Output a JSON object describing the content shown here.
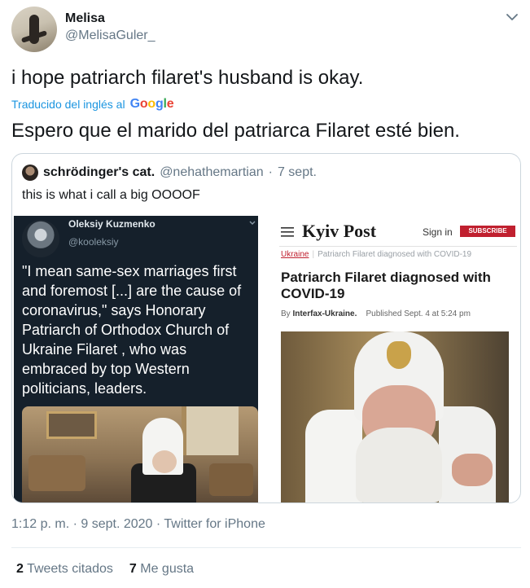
{
  "author": {
    "name": "Melisa",
    "handle": "@MelisaGuler_"
  },
  "tweet": {
    "text": "i hope patriarch filaret's husband is okay.",
    "translated_label": "Traducido del inglés al",
    "google_letters": [
      "G",
      "o",
      "o",
      "g",
      "l",
      "e"
    ],
    "translation": "Espero que el marido del patriarca Filaret esté bien."
  },
  "quoted": {
    "name": "schrödinger's cat.",
    "handle": "@nehathemartian",
    "dot": "·",
    "date": "7 sept.",
    "text": "this is what i call a big OOOOF",
    "left_image": {
      "name": "Oleksiy Kuzmenko",
      "handle": "@kooleksiy",
      "text": "\"I mean same-sex marriages first and foremost [...] are the cause of coronavirus,\" says Honorary Patriarch of Orthodox Church of Ukraine Filaret , who was embraced by top Western politicians, leaders."
    },
    "right_image": {
      "logo": "Kyiv Post",
      "sign_in": "Sign in",
      "subscribe": "SUBSCRIBE",
      "category": "Ukraine",
      "crumb": "Patriarch Filaret diagnosed with COVID-19",
      "title": "Patriarch Filaret diagnosed with COVID-19",
      "by_label": "By",
      "byline": "Interfax-Ukraine.",
      "published": "Published Sept. 4 at 5:24 pm"
    }
  },
  "timestamp": "1:12 p. m. · 9 sept. 2020 · Twitter for iPhone",
  "stats": {
    "quotes_count": "2",
    "quotes_label": "Tweets citados",
    "likes_count": "7",
    "likes_label": "Me gusta"
  },
  "colors": {
    "link": "#1b95e0",
    "secondary": "#657786",
    "kyiv_red": "#c0202f",
    "dark_bg": "#15202b"
  }
}
